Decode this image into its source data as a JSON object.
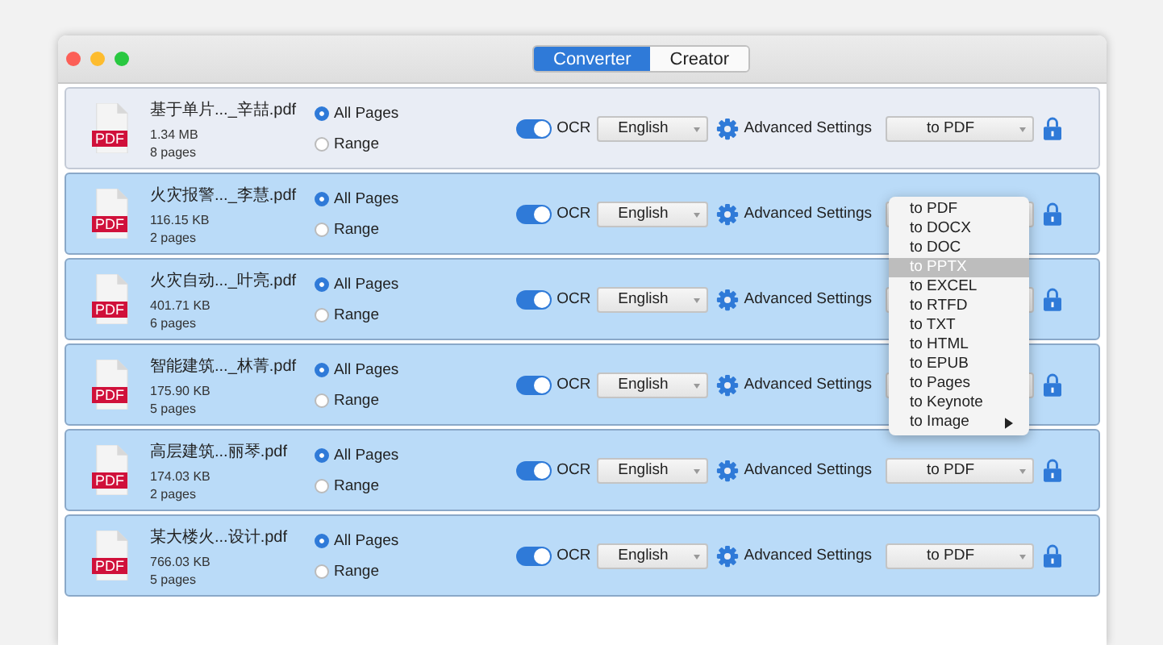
{
  "window": {
    "tabs": [
      {
        "label": "Converter",
        "selected": true
      },
      {
        "label": "Creator",
        "selected": false
      }
    ]
  },
  "files": [
    {
      "type_label": "PDF",
      "name": "基于单片..._辛喆.pdf",
      "size": "1.34 MB",
      "pages": "8 pages",
      "selected": false,
      "page_options": [
        {
          "label": "All Pages",
          "selected": true
        },
        {
          "label": "Range",
          "selected": false
        }
      ],
      "ocr": {
        "label": "OCR",
        "on": true
      },
      "language": "English",
      "settings_label": "Advanced Settings",
      "format": "to PDF"
    },
    {
      "type_label": "PDF",
      "name": "火灾报警..._李慧.pdf",
      "size": "116.15 KB",
      "pages": "2 pages",
      "selected": true,
      "page_options": [
        {
          "label": "All Pages",
          "selected": true
        },
        {
          "label": "Range",
          "selected": false
        }
      ],
      "ocr": {
        "label": "OCR",
        "on": true
      },
      "language": "English",
      "settings_label": "Advanced Settings"
    },
    {
      "type_label": "PDF",
      "name": "火灾自动..._叶亮.pdf",
      "size": "401.71 KB",
      "pages": "6 pages",
      "selected": true,
      "page_options": [
        {
          "label": "All Pages",
          "selected": true
        },
        {
          "label": "Range",
          "selected": false
        }
      ],
      "ocr": {
        "label": "OCR",
        "on": true
      },
      "language": "English",
      "settings_label": "Advanced Settings"
    },
    {
      "type_label": "PDF",
      "name": "智能建筑..._林菁.pdf",
      "size": "175.90 KB",
      "pages": "5 pages",
      "selected": true,
      "page_options": [
        {
          "label": "All Pages",
          "selected": true
        },
        {
          "label": "Range",
          "selected": false
        }
      ],
      "ocr": {
        "label": "OCR",
        "on": true
      },
      "language": "English",
      "settings_label": "Advanced Settings"
    },
    {
      "type_label": "PDF",
      "name": "高层建筑...丽琴.pdf",
      "size": "174.03 KB",
      "pages": "2 pages",
      "selected": true,
      "page_options": [
        {
          "label": "All Pages",
          "selected": true
        },
        {
          "label": "Range",
          "selected": false
        }
      ],
      "ocr": {
        "label": "OCR",
        "on": true
      },
      "language": "English",
      "settings_label": "Advanced Settings",
      "format": "to PDF"
    },
    {
      "type_label": "PDF",
      "name": "某大楼火...设计.pdf",
      "size": "766.03 KB",
      "pages": "5 pages",
      "selected": true,
      "page_options": [
        {
          "label": "All Pages",
          "selected": true
        },
        {
          "label": "Range",
          "selected": false
        }
      ],
      "ocr": {
        "label": "OCR",
        "on": true
      },
      "language": "English",
      "settings_label": "Advanced Settings",
      "format": "to PDF"
    }
  ],
  "format_menu": {
    "items": [
      {
        "label": "to PDF",
        "selected": false,
        "submenu": false
      },
      {
        "label": "to DOCX",
        "selected": false,
        "submenu": false
      },
      {
        "label": "to DOC",
        "selected": false,
        "submenu": false
      },
      {
        "label": "to PPTX",
        "selected": true,
        "submenu": false
      },
      {
        "label": "to EXCEL",
        "selected": false,
        "submenu": false
      },
      {
        "label": "to RTFD",
        "selected": false,
        "submenu": false
      },
      {
        "label": "to TXT",
        "selected": false,
        "submenu": false
      },
      {
        "label": "to HTML",
        "selected": false,
        "submenu": false
      },
      {
        "label": "to EPUB",
        "selected": false,
        "submenu": false
      },
      {
        "label": "to Pages",
        "selected": false,
        "submenu": false
      },
      {
        "label": "to Keynote",
        "selected": false,
        "submenu": false
      },
      {
        "label": "to Image",
        "selected": false,
        "submenu": true
      }
    ]
  }
}
